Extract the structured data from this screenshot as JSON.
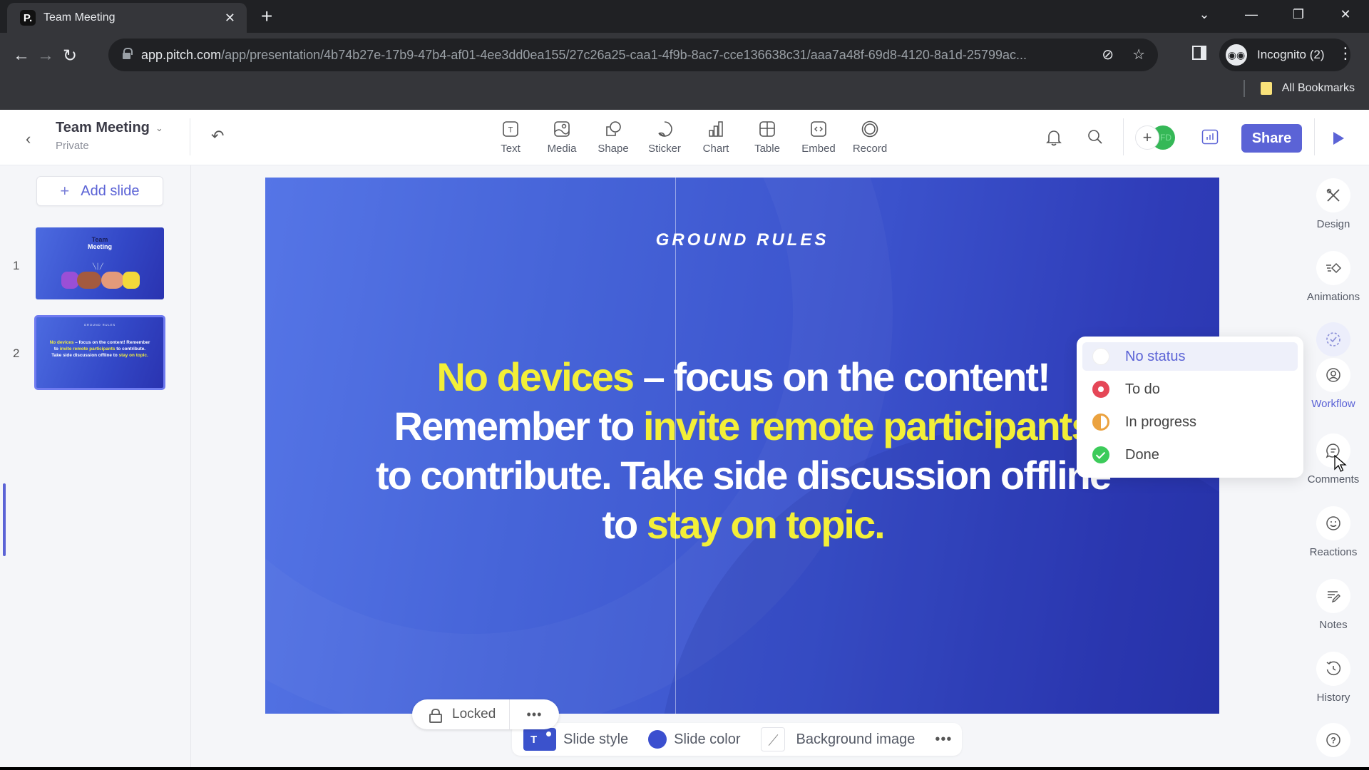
{
  "browser": {
    "tab_title": "Team Meeting",
    "favicon_letter": "P.",
    "url_host": "app.pitch.com",
    "url_path": "/app/presentation/4b74b27e-17b9-47b4-af01-4ee3dd0ea155/27c26a25-caa1-4f9b-8ac7-cce136638c31/aaa7a48f-69d8-4120-8a1d-25799ac...",
    "profile_label": "Incognito (2)",
    "bookmarks_label": "All Bookmarks"
  },
  "header": {
    "doc_title": "Team Meeting",
    "doc_visibility": "Private",
    "tools": [
      {
        "label": "Text",
        "icon": "text-icon"
      },
      {
        "label": "Media",
        "icon": "media-icon"
      },
      {
        "label": "Shape",
        "icon": "shape-icon"
      },
      {
        "label": "Sticker",
        "icon": "sticker-icon"
      },
      {
        "label": "Chart",
        "icon": "chart-icon"
      },
      {
        "label": "Table",
        "icon": "table-icon"
      },
      {
        "label": "Embed",
        "icon": "embed-icon"
      },
      {
        "label": "Record",
        "icon": "record-icon"
      }
    ],
    "avatar_initials": "FD",
    "share_label": "Share"
  },
  "sidebar": {
    "add_slide_label": "Add slide",
    "slides": [
      {
        "number": "1",
        "title_line1": "Team",
        "title_line2": "Meeting"
      },
      {
        "number": "2",
        "heading": "GROUND RULES",
        "active": true
      }
    ]
  },
  "slide": {
    "heading": "GROUND RULES",
    "body": [
      {
        "text": "No devices",
        "highlight": true
      },
      {
        "text": " – focus on the content! Remember to ",
        "highlight": false
      },
      {
        "text": "invite remote participants",
        "highlight": true
      },
      {
        "text": " to contribute. Take side discussion offline to ",
        "highlight": false
      },
      {
        "text": "stay on topic.",
        "highlight": true
      }
    ],
    "locked_label": "Locked",
    "more_label": "•••"
  },
  "bottom_bar": {
    "slide_style_label": "Slide style",
    "slide_style_letter": "T",
    "slide_color_label": "Slide color",
    "background_image_label": "Background image",
    "more_label": "•••"
  },
  "right_rail": [
    {
      "label": "Design",
      "icon": "design-icon"
    },
    {
      "label": "Animations",
      "icon": "animations-icon"
    },
    {
      "label": "Workflow",
      "icon": "workflow-icon",
      "active": true
    },
    {
      "label": "Comments",
      "icon": "comments-icon"
    },
    {
      "label": "Reactions",
      "icon": "reactions-icon"
    },
    {
      "label": "Notes",
      "icon": "notes-icon"
    },
    {
      "label": "History",
      "icon": "history-icon"
    }
  ],
  "status_menu": {
    "options": [
      {
        "label": "No status",
        "color": "#ffffff",
        "selected": true
      },
      {
        "label": "To do",
        "color": "#e54757"
      },
      {
        "label": "In progress",
        "color": "#eba23f"
      },
      {
        "label": "Done",
        "color": "#3ccb5a"
      }
    ]
  },
  "colors": {
    "accent": "#5b63d6",
    "slide_bg": "#3b52cc",
    "highlight_text": "#f3ef38"
  }
}
